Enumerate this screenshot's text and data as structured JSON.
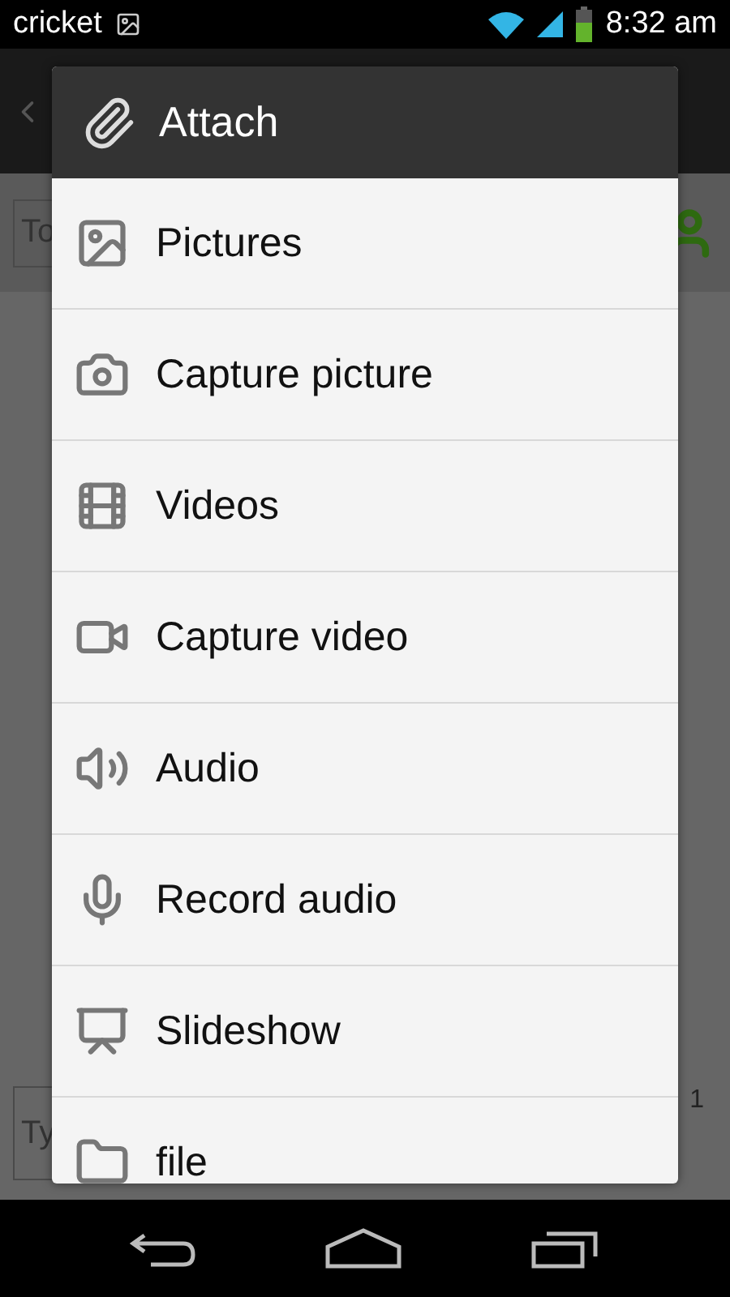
{
  "status_bar": {
    "carrier": "cricket",
    "time": "8:32 am"
  },
  "background": {
    "recipient_placeholder": "To",
    "compose_placeholder": "Ty",
    "counter": "1"
  },
  "dialog": {
    "title": "Attach",
    "items": [
      {
        "kind": "pictures",
        "label": "Pictures"
      },
      {
        "kind": "camera",
        "label": "Capture picture"
      },
      {
        "kind": "videos",
        "label": "Videos"
      },
      {
        "kind": "video-camera",
        "label": "Capture video"
      },
      {
        "kind": "audio",
        "label": "Audio"
      },
      {
        "kind": "microphone",
        "label": "Record audio"
      },
      {
        "kind": "slideshow",
        "label": "Slideshow"
      },
      {
        "kind": "folder",
        "label": "file"
      }
    ]
  }
}
